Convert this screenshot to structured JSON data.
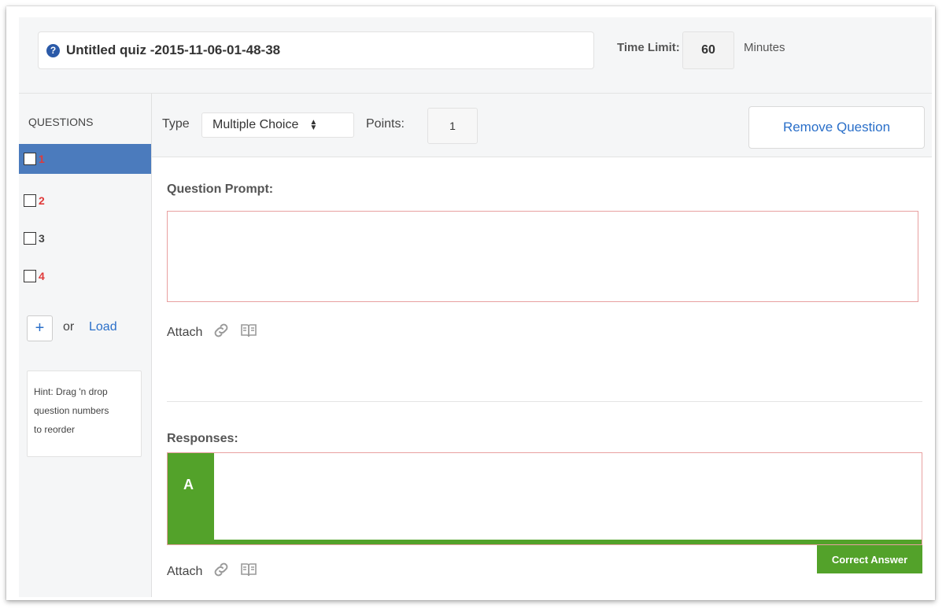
{
  "quiz": {
    "title": "Untitled quiz -2015-11-06-01-48-38",
    "time_limit_label": "Time Limit:",
    "time_limit_value": "60",
    "time_unit": "Minutes"
  },
  "sidebar": {
    "title": "QUESTIONS",
    "items": [
      {
        "number": "1",
        "state": "selected"
      },
      {
        "number": "2",
        "state": "incomplete"
      },
      {
        "number": "3",
        "state": "complete"
      },
      {
        "number": "4",
        "state": "incomplete"
      }
    ],
    "add_icon": "+",
    "or_text": "or",
    "load_label": "Load",
    "hint_lines": [
      "Hint: Drag 'n drop",
      "question numbers",
      "to reorder"
    ]
  },
  "toolbar": {
    "type_label": "Type",
    "type_value": "Multiple Choice",
    "points_label": "Points:",
    "points_value": "1",
    "remove_label": "Remove Question"
  },
  "prompt": {
    "label": "Question Prompt:",
    "attach_label": "Attach"
  },
  "responses": {
    "label": "Responses:",
    "letter": "A",
    "attach_label": "Attach",
    "correct_label": "Correct Answer"
  },
  "colors": {
    "accent_blue": "#2a6fc9",
    "selected_bg": "#4b7bbd",
    "correct_green": "#53a22a",
    "error_red": "#e03a3a"
  }
}
